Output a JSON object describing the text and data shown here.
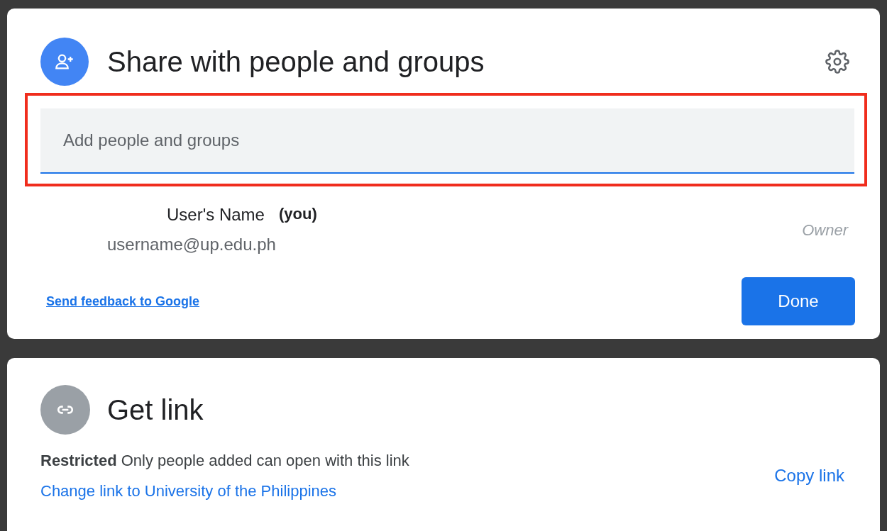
{
  "share": {
    "title": "Share with people and groups",
    "field": {
      "placeholder": "Add people and groups",
      "highlighted": true
    },
    "people": [
      {
        "name": "User's Name",
        "tag": "(you)",
        "email": "username@up.edu.ph",
        "role": "Owner"
      }
    ],
    "feedback_link": "Send feedback to Google",
    "done_button": "Done"
  },
  "get_link": {
    "title": "Get link",
    "description": "**Restricted** Only people added can open with this link",
    "change_link": "Change link to University of the Philippines",
    "copy_link": "Copy link"
  }
}
